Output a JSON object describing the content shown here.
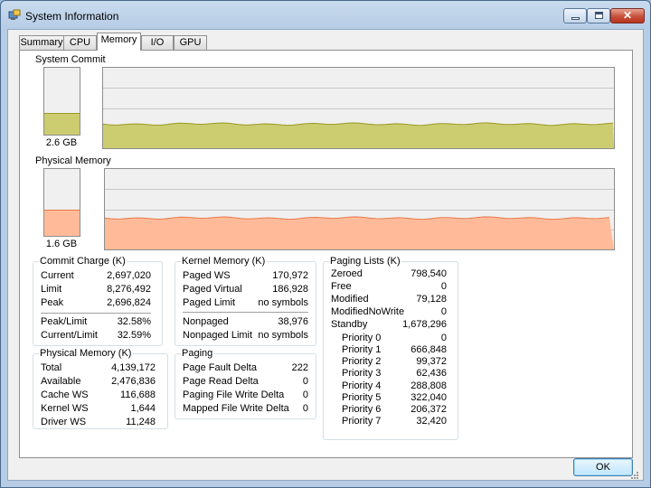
{
  "window": {
    "title": "System Information",
    "close_glyph": "✕"
  },
  "colors": {
    "commit_fill": "#cccc70",
    "commit_line": "#9a9a24",
    "physical_fill": "#ffbb99",
    "physical_line": "#e87a4c"
  },
  "icons": {
    "app": "system-info-app-icon",
    "minimize": "minimize-icon",
    "maximize": "maximize-icon",
    "close": "close-icon",
    "grip": "resize-grip-icon"
  },
  "tabs": [
    {
      "label": "Summary",
      "active": false
    },
    {
      "label": "CPU",
      "active": false
    },
    {
      "label": "Memory",
      "active": true
    },
    {
      "label": "I/O",
      "active": false
    },
    {
      "label": "GPU",
      "active": false
    }
  ],
  "system_commit": {
    "label": "System Commit",
    "gauge_value": "2.6 GB",
    "gauge_fill_fraction": 0.31,
    "history_level_fraction": 0.3
  },
  "physical_memory_graph": {
    "label": "Physical Memory",
    "gauge_value": "1.6 GB",
    "gauge_fill_fraction": 0.38,
    "history_level_fraction": 0.39
  },
  "commit_charge": {
    "title": "Commit Charge (K)",
    "rows": [
      {
        "label": "Current",
        "value": "2,697,020"
      },
      {
        "label": "Limit",
        "value": "8,276,492"
      },
      {
        "label": "Peak",
        "value": "2,696,824"
      }
    ],
    "ratios": [
      {
        "label": "Peak/Limit",
        "value": "32.58%"
      },
      {
        "label": "Current/Limit",
        "value": "32.59%"
      }
    ]
  },
  "physical_memory": {
    "title": "Physical Memory (K)",
    "rows": [
      {
        "label": "Total",
        "value": "4,139,172"
      },
      {
        "label": "Available",
        "value": "2,476,836"
      },
      {
        "label": "Cache WS",
        "value": "116,688"
      },
      {
        "label": "Kernel WS",
        "value": "1,644"
      },
      {
        "label": "Driver WS",
        "value": "11,248"
      }
    ]
  },
  "kernel_memory": {
    "title": "Kernel Memory (K)",
    "rows": [
      {
        "label": "Paged WS",
        "value": "170,972"
      },
      {
        "label": "Paged Virtual",
        "value": "186,928"
      },
      {
        "label": "Paged Limit",
        "value": "no symbols"
      }
    ],
    "rows2": [
      {
        "label": "Nonpaged",
        "value": "38,976"
      },
      {
        "label": "Nonpaged Limit",
        "value": "no symbols"
      }
    ]
  },
  "paging": {
    "title": "Paging",
    "rows": [
      {
        "label": "Page Fault Delta",
        "value": "222"
      },
      {
        "label": "Page Read Delta",
        "value": "0"
      },
      {
        "label": "Paging File Write Delta",
        "value": "0"
      },
      {
        "label": "Mapped File Write Delta",
        "value": "0"
      }
    ]
  },
  "paging_lists": {
    "title": "Paging Lists (K)",
    "rows": [
      {
        "label": "Zeroed",
        "value": "798,540"
      },
      {
        "label": "Free",
        "value": "0"
      },
      {
        "label": "Modified",
        "value": "79,128"
      },
      {
        "label": "ModifiedNoWrite",
        "value": "0"
      },
      {
        "label": "Standby",
        "value": "1,678,296"
      }
    ],
    "priorities": [
      {
        "label": "Priority 0",
        "value": "0"
      },
      {
        "label": "Priority 1",
        "value": "666,848"
      },
      {
        "label": "Priority 2",
        "value": "99,372"
      },
      {
        "label": "Priority 3",
        "value": "62,436"
      },
      {
        "label": "Priority 4",
        "value": "288,808"
      },
      {
        "label": "Priority 5",
        "value": "322,040"
      },
      {
        "label": "Priority 6",
        "value": "206,372"
      },
      {
        "label": "Priority 7",
        "value": "32,420"
      }
    ]
  },
  "buttons": {
    "ok": "OK"
  }
}
